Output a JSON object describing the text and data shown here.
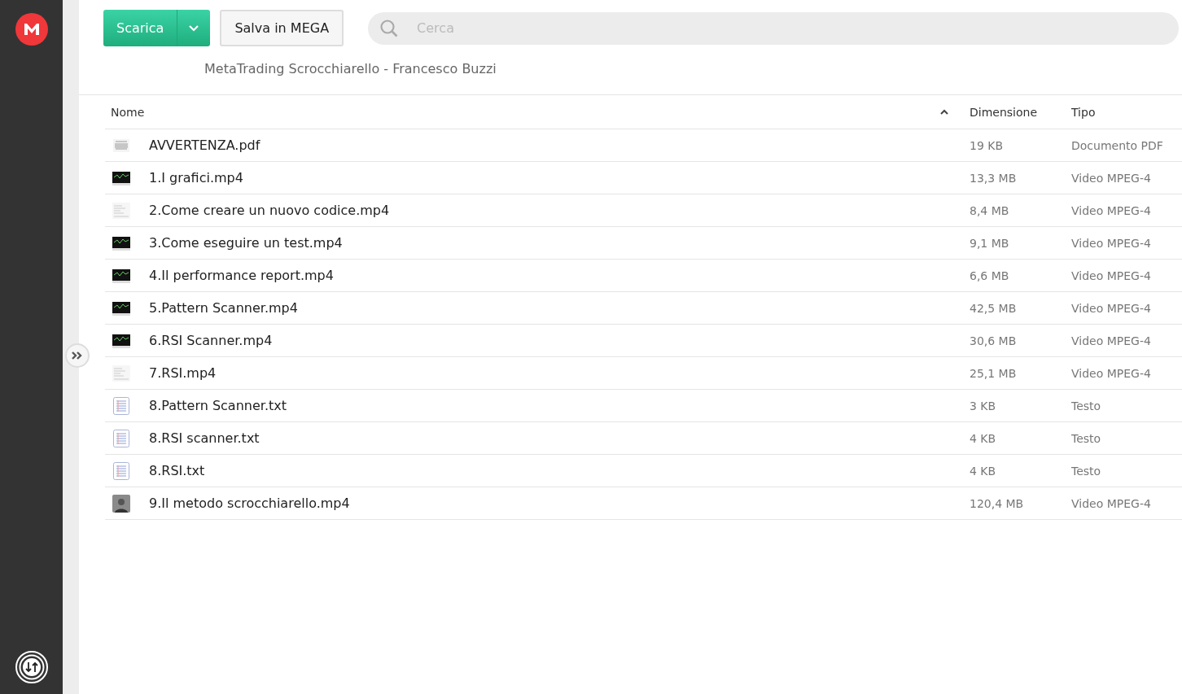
{
  "toolbar": {
    "download_button": "Scarica",
    "save_button": "Salva in MEGA",
    "search": {
      "placeholder": "Cerca"
    }
  },
  "breadcrumb": "MetaTrading Scrocchiarello - Francesco Buzzi",
  "table": {
    "columns": [
      {
        "label": "Nome",
        "sorted": true
      },
      {
        "label": "Dimensione",
        "sorted": false
      },
      {
        "label": "Tipo",
        "sorted": false
      }
    ],
    "rows": [
      {
        "kind": "pdf",
        "name": "AVVERTENZA.pdf",
        "size": "19 KB",
        "type": "Documento PDF"
      },
      {
        "kind": "video-dark",
        "name": "1.I grafici.mp4",
        "size": "13,3 MB",
        "type": "Video MPEG-4"
      },
      {
        "kind": "video-light",
        "name": "2.Come creare un nuovo codice.mp4",
        "size": "8,4 MB",
        "type": "Video MPEG-4"
      },
      {
        "kind": "video-dark",
        "name": "3.Come eseguire un test.mp4",
        "size": "9,1 MB",
        "type": "Video MPEG-4"
      },
      {
        "kind": "video-dark",
        "name": "4.Il performance report.mp4",
        "size": "6,6 MB",
        "type": "Video MPEG-4"
      },
      {
        "kind": "video-dark",
        "name": "5.Pattern Scanner.mp4",
        "size": "42,5 MB",
        "type": "Video MPEG-4"
      },
      {
        "kind": "video-dark",
        "name": "6.RSI Scanner.mp4",
        "size": "30,6 MB",
        "type": "Video MPEG-4"
      },
      {
        "kind": "video-light",
        "name": "7.RSI.mp4",
        "size": "25,1 MB",
        "type": "Video MPEG-4"
      },
      {
        "kind": "text",
        "name": "8.Pattern Scanner.txt",
        "size": "3 KB",
        "type": "Testo"
      },
      {
        "kind": "text",
        "name": "8.RSI scanner.txt",
        "size": "4 KB",
        "type": "Testo"
      },
      {
        "kind": "text",
        "name": "8.RSI.txt",
        "size": "4 KB",
        "type": "Testo"
      },
      {
        "kind": "photo",
        "name": "9.Il metodo scrocchiarello.mp4",
        "size": "120,4 MB",
        "type": "Video MPEG-4"
      }
    ]
  }
}
